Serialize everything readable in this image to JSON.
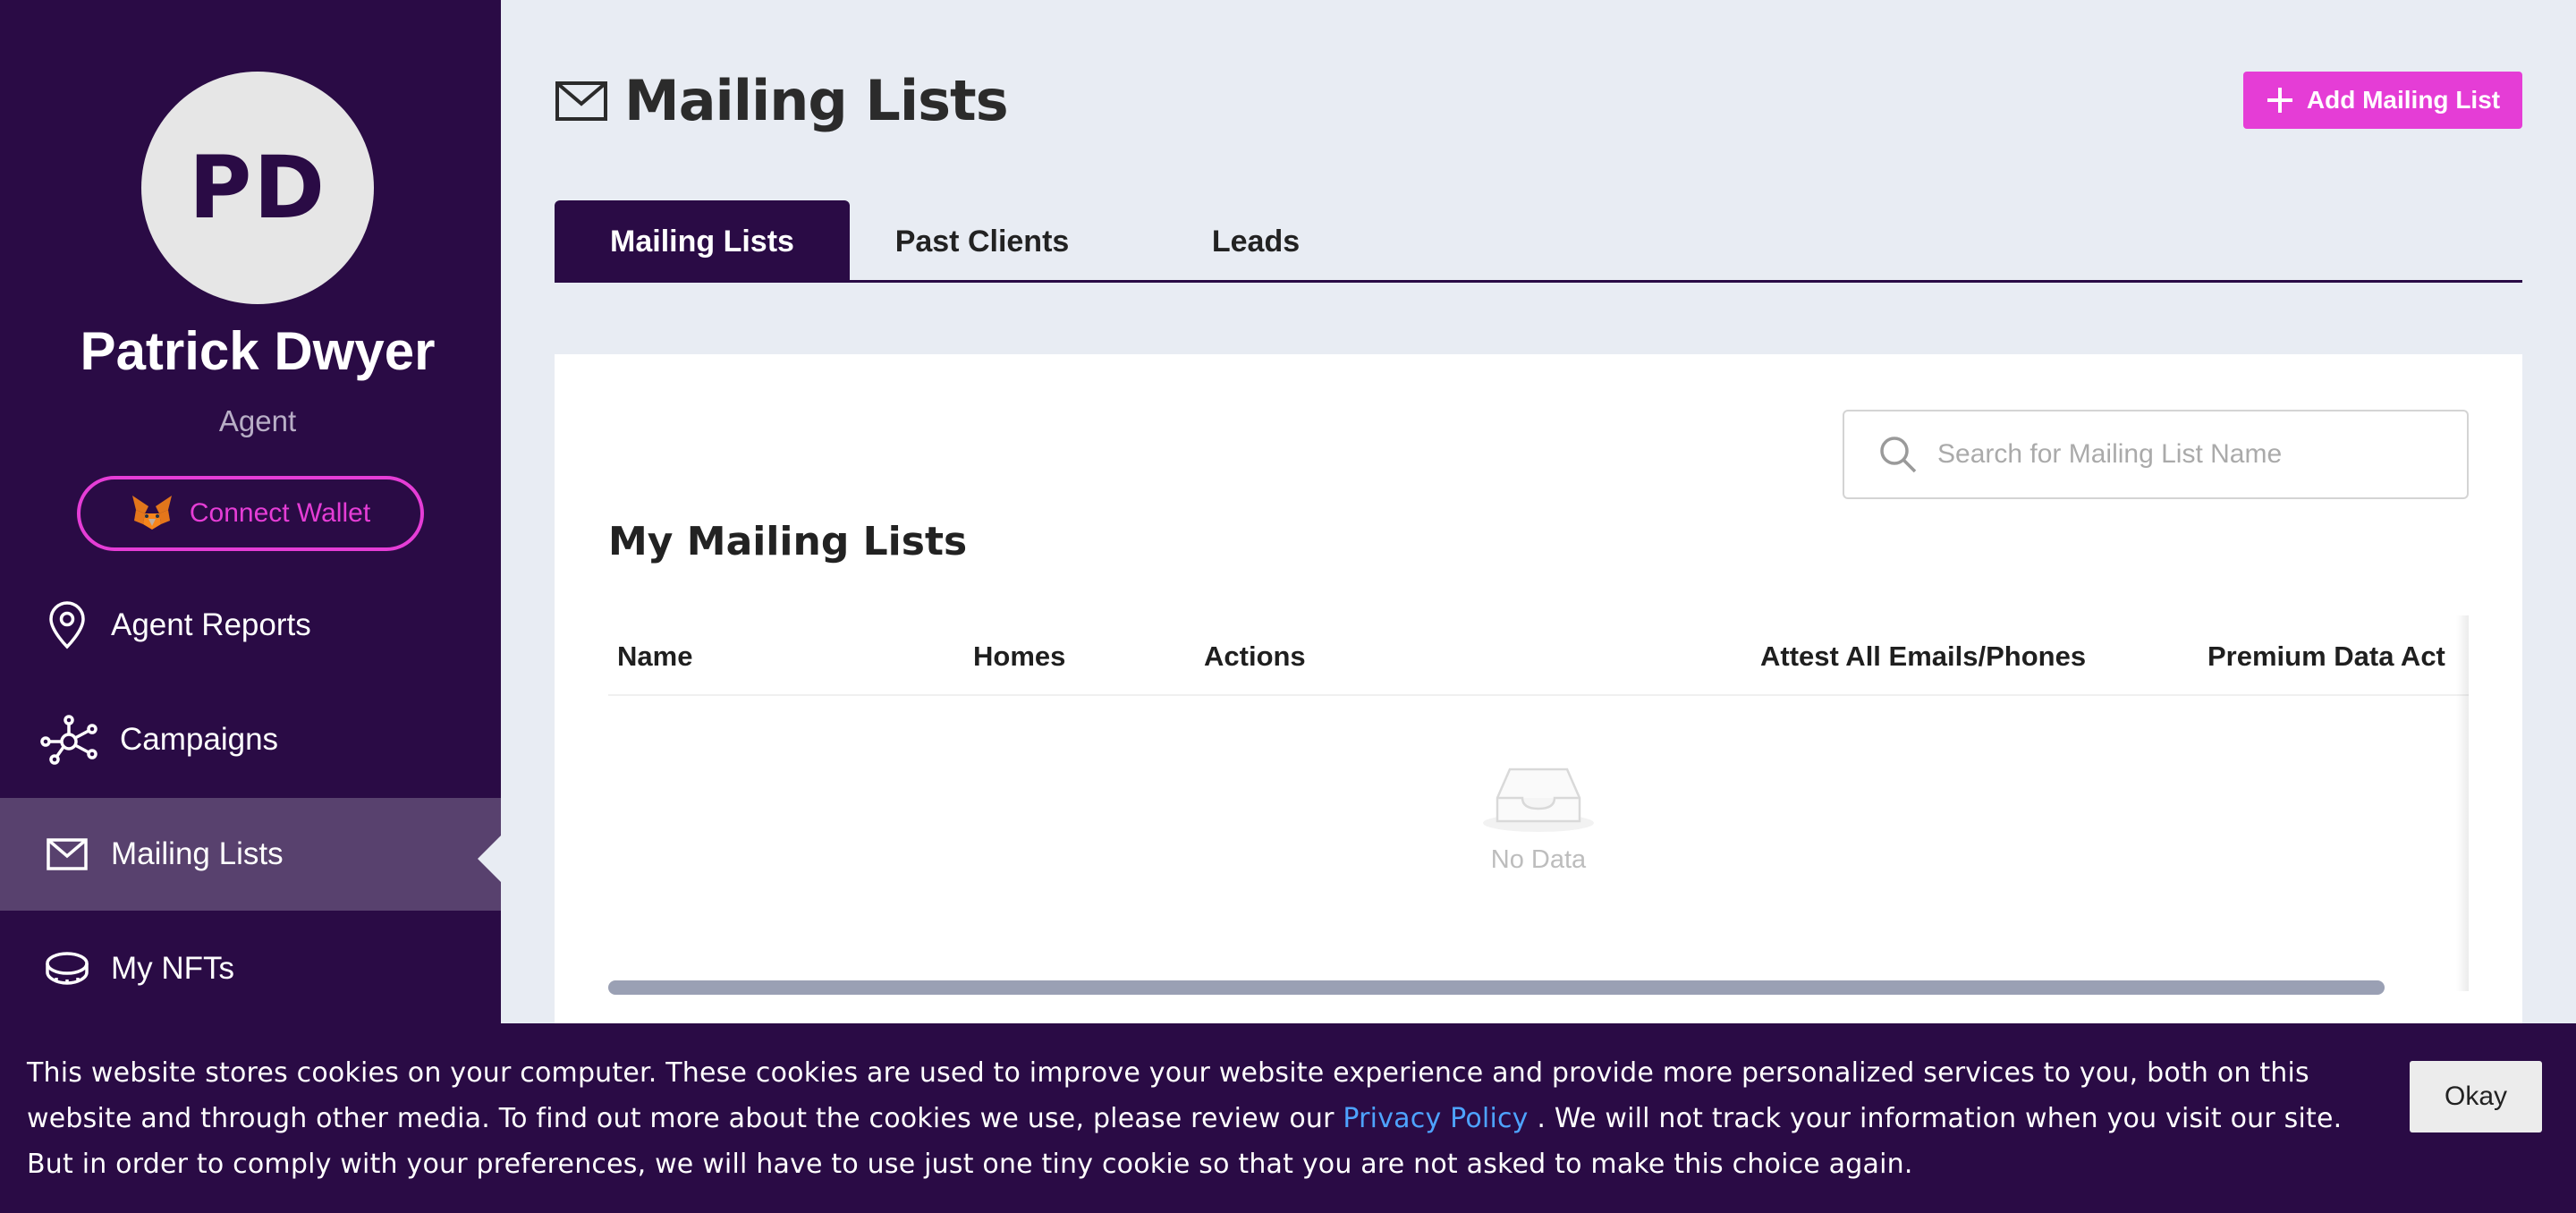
{
  "sidebar": {
    "avatar_initials": "PD",
    "user_name": "Patrick Dwyer",
    "user_role": "Agent",
    "connect_wallet_label": "Connect Wallet",
    "wallet_icon": "metamask-fox-icon",
    "nav_items": [
      {
        "label": "Agent Reports",
        "icon": "location-pin-icon",
        "active": false
      },
      {
        "label": "Campaigns",
        "icon": "network-nodes-icon",
        "active": false
      },
      {
        "label": "Mailing Lists",
        "icon": "envelope-icon",
        "active": true
      },
      {
        "label": "My NFTs",
        "icon": "coin-icon",
        "active": false
      }
    ]
  },
  "header": {
    "title": "Mailing Lists",
    "title_icon": "envelope-icon",
    "add_button_label": "Add Mailing List"
  },
  "tabs": [
    {
      "label": "Mailing Lists",
      "active": true
    },
    {
      "label": "Past Clients",
      "active": false
    },
    {
      "label": "Leads",
      "active": false
    }
  ],
  "card": {
    "search_placeholder": "Search for Mailing List Name",
    "heading": "My Mailing Lists",
    "table": {
      "columns": [
        "Name",
        "Homes",
        "Actions",
        "Attest All Emails/Phones",
        "Premium Data Act"
      ],
      "rows": [],
      "empty_text": "No Data"
    }
  },
  "cookie_banner": {
    "text_before_link": "This website stores cookies on your computer. These cookies are used to improve your website experience and provide more personalized services to you, both on this website and through other media. To find out more about the cookies we use, please review our ",
    "link_text": "Privacy Policy",
    "text_after_link": " . We will not track your information when you visit our site. But in order to comply with your preferences, we will have to use just one tiny cookie so that you are not asked to make this choice again.",
    "okay_label": "Okay"
  },
  "colors": {
    "sidebar_bg": "#2a0b45",
    "accent_pink": "#e53dd6",
    "active_nav_bg": "#58416e",
    "page_bg": "#e8ecf3",
    "link_blue": "#4ea3ff"
  }
}
